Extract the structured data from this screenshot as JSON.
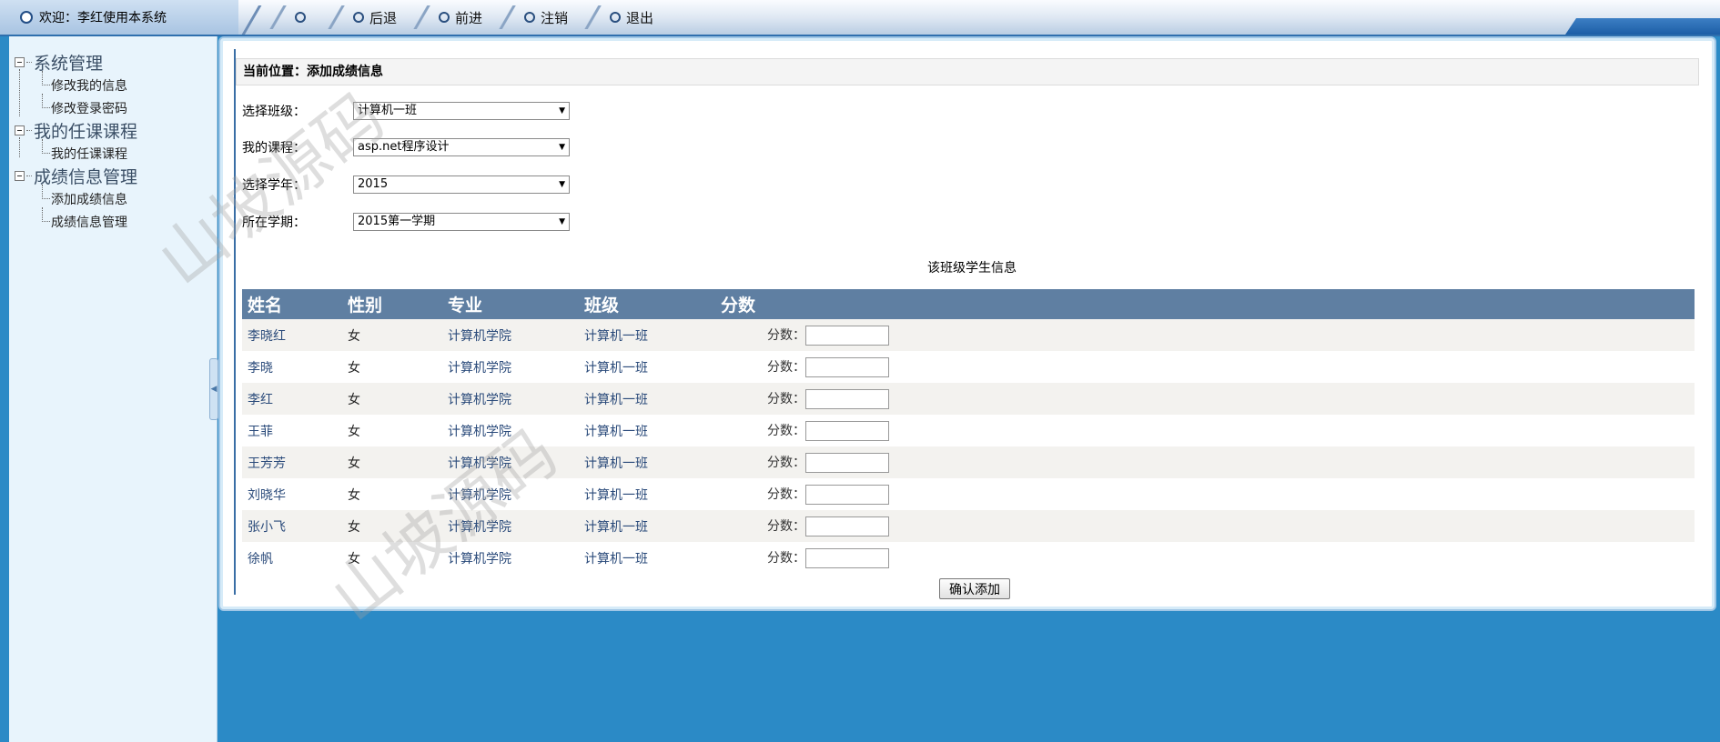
{
  "header": {
    "welcome": "欢迎：李红使用本系统",
    "nav": [
      "",
      "后退",
      "前进",
      "注销",
      "退出"
    ]
  },
  "sidebar": {
    "groups": [
      {
        "label": "系统管理",
        "items": [
          "修改我的信息",
          "修改登录密码"
        ]
      },
      {
        "label": "我的任课课程",
        "items": [
          "我的任课课程"
        ]
      },
      {
        "label": "成绩信息管理",
        "items": [
          "添加成绩信息",
          "成绩信息管理"
        ]
      }
    ]
  },
  "main": {
    "location": "当前位置：添加成绩信息",
    "form": [
      {
        "label": "选择班级：",
        "value": "计算机一班"
      },
      {
        "label": "我的课程：",
        "value": "asp.net程序设计"
      },
      {
        "label": "选择学年：",
        "value": "2015"
      },
      {
        "label": "所在学期：",
        "value": "2015第一学期"
      }
    ],
    "table_caption": "该班级学生信息",
    "columns": [
      "姓名",
      "性别",
      "专业",
      "班级",
      "分数"
    ],
    "score_label": "分数：",
    "rows": [
      {
        "name": "李晓红",
        "sex": "女",
        "major": "计算机学院",
        "class": "计算机一班"
      },
      {
        "name": "李晓",
        "sex": "女",
        "major": "计算机学院",
        "class": "计算机一班"
      },
      {
        "name": "李红",
        "sex": "女",
        "major": "计算机学院",
        "class": "计算机一班"
      },
      {
        "name": "王菲",
        "sex": "女",
        "major": "计算机学院",
        "class": "计算机一班"
      },
      {
        "name": "王芳芳",
        "sex": "女",
        "major": "计算机学院",
        "class": "计算机一班"
      },
      {
        "name": "刘晓华",
        "sex": "女",
        "major": "计算机学院",
        "class": "计算机一班"
      },
      {
        "name": "张小飞",
        "sex": "女",
        "major": "计算机学院",
        "class": "计算机一班"
      },
      {
        "name": "徐帆",
        "sex": "女",
        "major": "计算机学院",
        "class": "计算机一班"
      }
    ],
    "confirm_label": "确认添加"
  },
  "watermark": "山坡源码"
}
